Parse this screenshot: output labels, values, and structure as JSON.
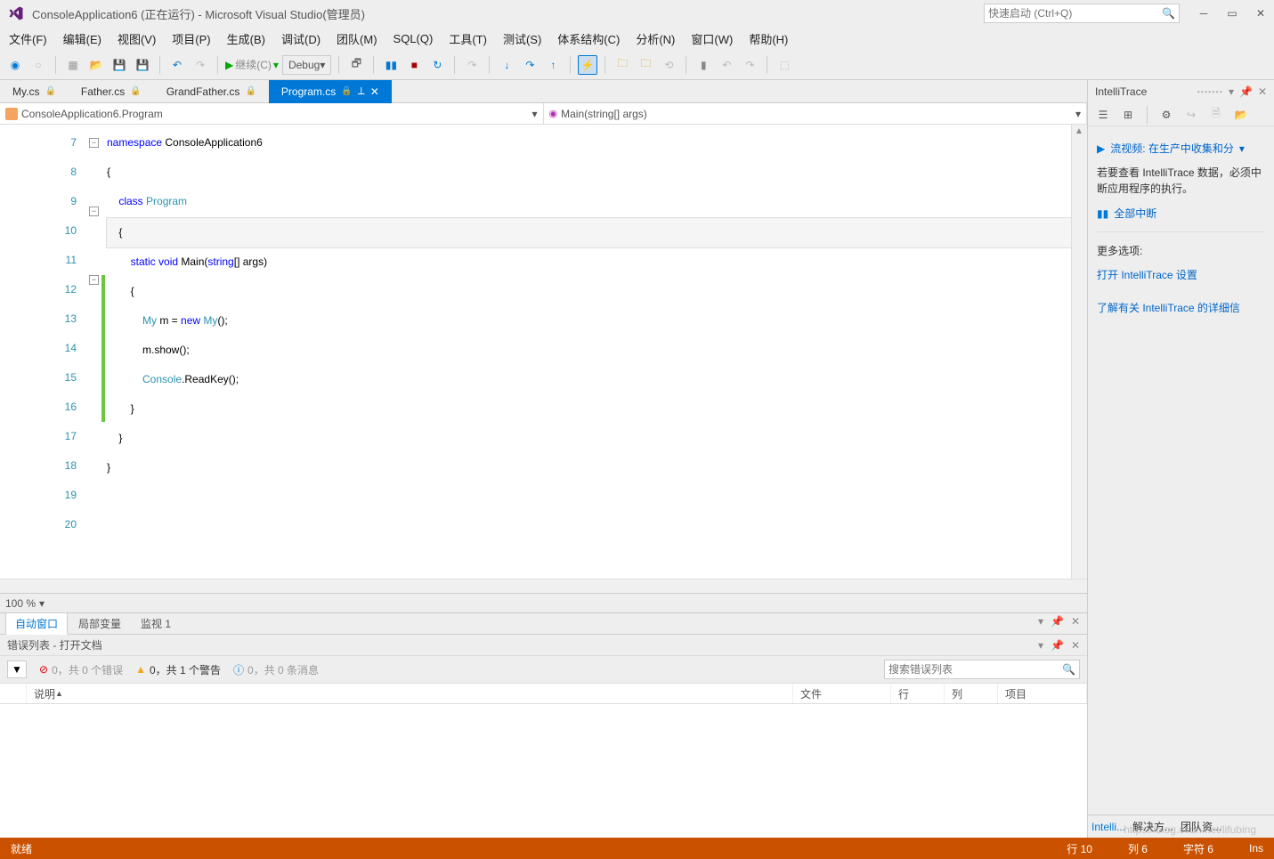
{
  "title": "ConsoleApplication6 (正在运行) - Microsoft Visual Studio(管理员)",
  "quickLaunch": {
    "placeholder": "快速启动 (Ctrl+Q)"
  },
  "menu": [
    "文件(F)",
    "编辑(E)",
    "视图(V)",
    "项目(P)",
    "生成(B)",
    "调试(D)",
    "团队(M)",
    "SQL(Q)",
    "工具(T)",
    "测试(S)",
    "体系结构(C)",
    "分析(N)",
    "窗口(W)",
    "帮助(H)"
  ],
  "toolbar": {
    "continue": "继续(C)",
    "config": "Debug"
  },
  "tabs": [
    {
      "name": "My.cs",
      "locked": true,
      "active": false
    },
    {
      "name": "Father.cs",
      "locked": true,
      "active": false
    },
    {
      "name": "GrandFather.cs",
      "locked": true,
      "active": false
    },
    {
      "name": "Program.cs",
      "locked": true,
      "active": true
    }
  ],
  "nav": {
    "left": "ConsoleApplication6.Program",
    "right": "Main(string[] args)"
  },
  "code": {
    "startLine": 7,
    "lines": [
      {
        "n": 7,
        "fold": "-",
        "html": "<span class='kw'>namespace</span> ConsoleApplication6"
      },
      {
        "n": 8,
        "html": "{"
      },
      {
        "n": 9,
        "fold": "-",
        "html": "    <span class='kw'>class</span> <span class='type'>Program</span>"
      },
      {
        "n": 10,
        "cursor": true,
        "html": "    {"
      },
      {
        "n": 11,
        "fold": "-",
        "html": "        <span class='kw'>static</span> <span class='kw'>void</span> Main(<span class='kw'>string</span>[] args)"
      },
      {
        "n": 12,
        "change": true,
        "html": "        {"
      },
      {
        "n": 13,
        "change": true,
        "html": "            <span class='type'>My</span> m = <span class='kw'>new</span> <span class='type'>My</span>();"
      },
      {
        "n": 14,
        "change": true,
        "html": "            m.show();"
      },
      {
        "n": 15,
        "change": true,
        "html": ""
      },
      {
        "n": 16,
        "change": true,
        "html": "            <span class='type'>Console</span>.ReadKey();"
      },
      {
        "n": 17,
        "html": "        }"
      },
      {
        "n": 18,
        "html": "    }"
      },
      {
        "n": 19,
        "html": "}"
      },
      {
        "n": 20,
        "html": ""
      }
    ]
  },
  "zoom": "100 %",
  "bottomTabs": [
    "自动窗口",
    "局部变量",
    "监视 1"
  ],
  "errorPanel": {
    "title": "错误列表 - 打开文档",
    "errors": "0，共 0 个错误",
    "warnings": "0，共 1 个警告",
    "messages": "0，共 0 条消息",
    "searchPlaceholder": "搜索错误列表",
    "cols": {
      "desc": "说明",
      "file": "文件",
      "line": "行",
      "col": "列",
      "proj": "项目"
    }
  },
  "intelli": {
    "title": "IntelliTrace",
    "video": "流视频: 在生产中收集和分",
    "text1": "若要查看 IntelliTrace 数据，必须中断应用程序的执行。",
    "breakAll": "全部中断",
    "more": "更多选项:",
    "link1": "打开 IntelliTrace 设置",
    "link2": "了解有关 IntelliTrace 的详细信",
    "tabs": [
      "Intelli...",
      "解决方...",
      "团队资..."
    ]
  },
  "status": {
    "ready": "就绪",
    "line": "行 10",
    "col": "列 6",
    "char": "字符 6",
    "ins": "Ins"
  },
  "watermark": "https://blog.csdn.net/lifubing"
}
